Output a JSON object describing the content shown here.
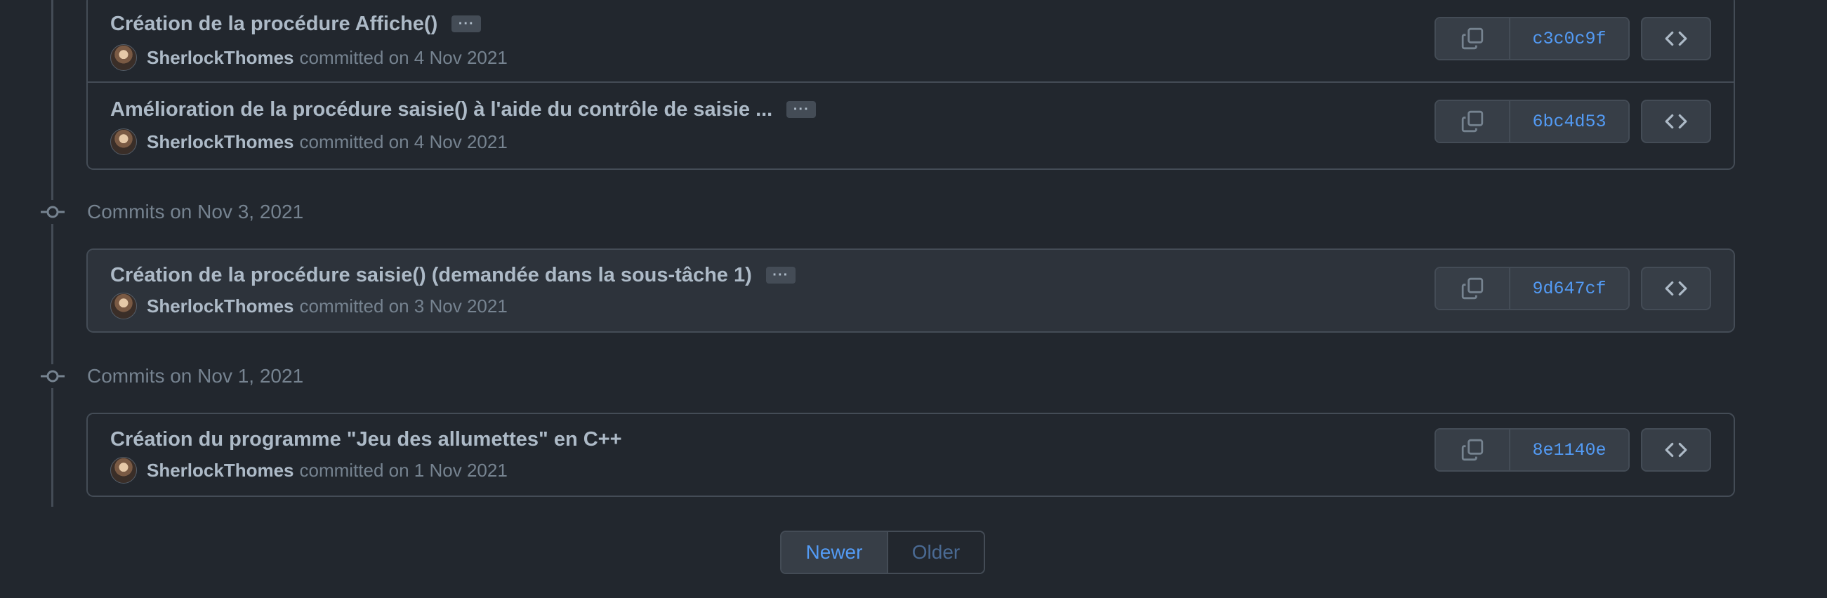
{
  "groups": [
    {
      "header": "",
      "commits": [
        {
          "message": "Création de la procédure Affiche()",
          "author": "SherlockThomes",
          "committed": "committed on 4 Nov 2021",
          "sha": "c3c0c9f",
          "has_ellipsis": true
        },
        {
          "message": "Amélioration de la procédure saisie() à l'aide du contrôle de saisie ...",
          "author": "SherlockThomes",
          "committed": "committed on 4 Nov 2021",
          "sha": "6bc4d53",
          "has_ellipsis": true
        }
      ]
    },
    {
      "header": "Commits on Nov 3, 2021",
      "commits": [
        {
          "message": "Création de la procédure saisie() (demandée dans la sous-tâche 1)",
          "author": "SherlockThomes",
          "committed": "committed on 3 Nov 2021",
          "sha": "9d647cf",
          "has_ellipsis": true
        }
      ]
    },
    {
      "header": "Commits on Nov 1, 2021",
      "commits": [
        {
          "message": "Création du programme \"Jeu des allumettes\" en C++",
          "author": "SherlockThomes",
          "committed": "committed on 1 Nov 2021",
          "sha": "8e1140e",
          "has_ellipsis": false
        }
      ]
    }
  ],
  "ellipsis_label": "···",
  "pagination": {
    "newer": "Newer",
    "older": "Older"
  },
  "icons": {
    "copy": "copy-icon",
    "browse": "code-icon",
    "commit": "git-commit-icon"
  },
  "colors": {
    "background": "#22272e",
    "row_background": "#2d333b",
    "border": "#444c56",
    "text": "#adbac7",
    "muted": "#768390",
    "link": "#539bf5"
  }
}
